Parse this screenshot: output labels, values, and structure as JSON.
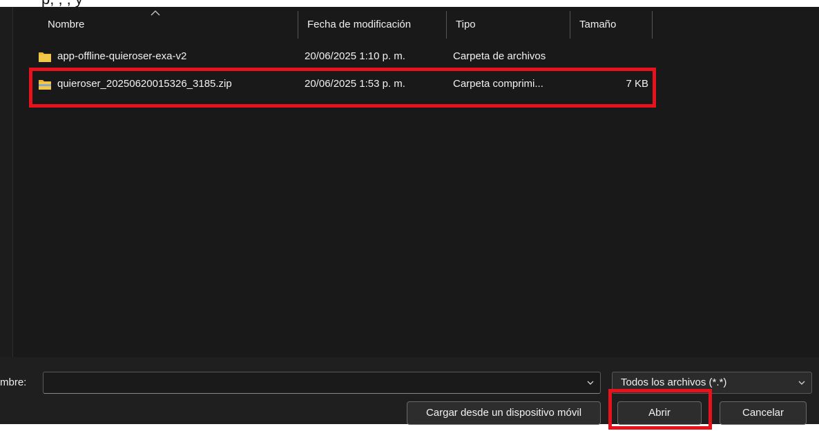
{
  "top_fragment": "p,  ,  ,  y",
  "columns": {
    "name": "Nombre",
    "modified": "Fecha de modificación",
    "type": "Tipo",
    "size": "Tamaño"
  },
  "files": [
    {
      "name": "app-offline-quieroser-exa-v2",
      "modified": "20/06/2025 1:10 p. m.",
      "type": "Carpeta de archivos",
      "size": "",
      "icon": "folder-icon"
    },
    {
      "name": "quieroser_20250620015326_3185.zip",
      "modified": "20/06/2025 1:53 p. m.",
      "type": "Carpeta comprimi...",
      "size": "7 KB",
      "icon": "zip-folder-icon"
    }
  ],
  "filename": {
    "label": "mbre:",
    "value": ""
  },
  "filter": {
    "selected": "Todos los archivos (*.*)"
  },
  "buttons": {
    "mobile": "Cargar desde un dispositivo móvil",
    "open": "Abrir",
    "cancel": "Cancelar"
  },
  "colors": {
    "highlight": "#e8121c",
    "folder": "#e8b931",
    "background": "#191919"
  }
}
